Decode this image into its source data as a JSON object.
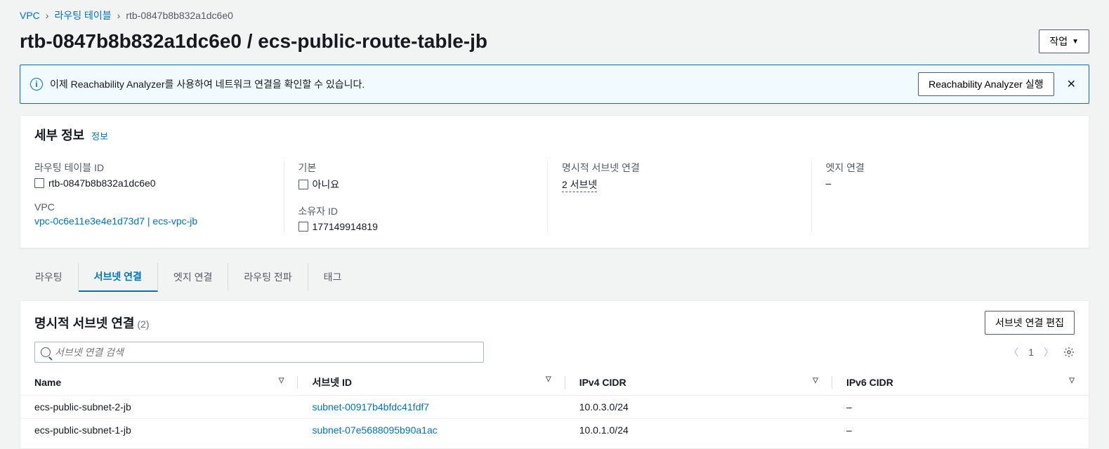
{
  "breadcrumb": {
    "vpc": "VPC",
    "rt": "라우팅 테이블",
    "current": "rtb-0847b8b832a1dc6e0"
  },
  "header": {
    "title": "rtb-0847b8b832a1dc6e0 / ecs-public-route-table-jb",
    "actions_label": "작업"
  },
  "banner": {
    "message": "이제 Reachability Analyzer를 사용하여 네트워크 연결을 확인할 수 있습니다.",
    "button": "Reachability Analyzer 실행"
  },
  "details": {
    "heading": "세부 정보",
    "info_link": "정보",
    "rt_id_label": "라우팅 테이블 ID",
    "rt_id_value": "rtb-0847b8b832a1dc6e0",
    "vpc_label": "VPC",
    "vpc_value": "vpc-0c6e11e3e4e1d73d7 | ecs-vpc-jb",
    "default_label": "기본",
    "default_value": "아니요",
    "owner_label": "소유자 ID",
    "owner_value": "177149914819",
    "explicit_label": "명시적 서브넷 연결",
    "explicit_value": "2 서브넷",
    "edge_label": "엣지 연결",
    "edge_value": "–"
  },
  "tabs": {
    "routing": "라우팅",
    "subnet": "서브넷 연결",
    "edge": "엣지 연결",
    "propagation": "라우팅 전파",
    "tags": "태그"
  },
  "subnet_section": {
    "heading": "명시적 서브넷 연결",
    "count": "(2)",
    "edit_button": "서브넷 연결 편집",
    "search_placeholder": "서브넷 연결 검색",
    "page": "1",
    "columns": {
      "name": "Name",
      "subnet_id": "서브넷 ID",
      "ipv4": "IPv4 CIDR",
      "ipv6": "IPv6 CIDR"
    },
    "rows": [
      {
        "name": "ecs-public-subnet-2-jb",
        "subnet_id": "subnet-00917b4bfdc41fdf7",
        "ipv4": "10.0.3.0/24",
        "ipv6": "–"
      },
      {
        "name": "ecs-public-subnet-1-jb",
        "subnet_id": "subnet-07e5688095b90a1ac",
        "ipv4": "10.0.1.0/24",
        "ipv6": "–"
      }
    ]
  }
}
